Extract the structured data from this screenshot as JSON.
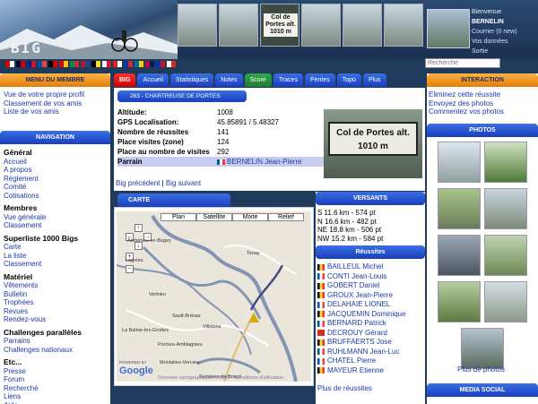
{
  "header": {
    "logo_text": "BIG",
    "thumb_sign": "Col de Portes alt. 1010 m",
    "user": {
      "welcome": "Bienvenue",
      "name": "BERNELIN",
      "mail": "Courrier (0 new)",
      "data": "Vos données",
      "logout": "Sortie"
    },
    "search_placeholder": "Recherche"
  },
  "flags": [
    {
      "colors": [
        "#d00",
        "#fff"
      ]
    },
    {
      "colors": [
        "#003",
        "#c00"
      ]
    },
    {
      "colors": [
        "#00247d",
        "#cf142b"
      ]
    },
    {
      "colors": [
        "#0055a4",
        "#ef4135"
      ]
    },
    {
      "colors": [
        "#000",
        "#dd0000"
      ]
    },
    {
      "colors": [
        "#c60b1e",
        "#ffc400"
      ]
    },
    {
      "colors": [
        "#009246",
        "#ce2b37"
      ]
    },
    {
      "colors": [
        "#ae1c28",
        "#21468b"
      ]
    },
    {
      "colors": [
        "#000",
        "#fdda24"
      ]
    },
    {
      "colors": [
        "#fff",
        "#dc143c"
      ]
    },
    {
      "colors": [
        "#d52b1e",
        "#fff"
      ]
    },
    {
      "colors": [
        "#0039a6",
        "#d52b1e"
      ]
    },
    {
      "colors": [
        "#006aa7",
        "#fecc00"
      ]
    },
    {
      "colors": [
        "#ba0c2f",
        "#00205b"
      ]
    },
    {
      "colors": [
        "#0038a8",
        "#ce1126"
      ]
    },
    {
      "colors": [
        "#fff",
        "#d52b1e"
      ]
    }
  ],
  "left_menu": {
    "member_title": "MENU DU MEMBRE",
    "member_links": [
      "Vue de votre propre profil",
      "Classement de vos amis",
      "Liste de vos amis"
    ],
    "nav_title": "NAVIGATION",
    "sections": [
      {
        "title": "Général",
        "items": [
          "Accueil",
          "A propos",
          "Règlement",
          "Comité",
          "Cotisations"
        ]
      },
      {
        "title": "Membres",
        "items": [
          "Vue générale",
          "Classement"
        ]
      },
      {
        "title": "Superliste 1000 Bigs",
        "items": [
          "Carte",
          "La liste",
          "Classement"
        ]
      },
      {
        "title": "Matériel",
        "items": [
          "Vêtements",
          "Bulletin",
          "Trophées",
          "Revues",
          "Rendez-vous"
        ]
      },
      {
        "title": "Challenges parallèles",
        "items": [
          "Parrains",
          "Challenges nationaux"
        ]
      },
      {
        "title": "Etc...",
        "items": [
          "Presse",
          "Forum",
          "Recherché",
          "Liens",
          "Aide"
        ]
      }
    ]
  },
  "tabs": [
    "BIG",
    "Accueil",
    "Statistiques",
    "Notes",
    "Score",
    "Traces",
    "Pentes",
    "Topo",
    "Plus"
  ],
  "col": {
    "title": "263 - CHARTREUSE DE PORTES",
    "rows": [
      {
        "k": "Altitude:",
        "v": "1008"
      },
      {
        "k": "GPS Localisation:",
        "v": "45.85891 / 5.48327"
      },
      {
        "k": "Nombre de réussites",
        "v": "141"
      },
      {
        "k": "Place visites (zone)",
        "v": "124"
      },
      {
        "k": "Place au nombre de visites",
        "v": "292"
      }
    ],
    "parrain_label": "Parrain",
    "parrain_value": "BERNELIN Jean-Pierre",
    "photo_sign": "Col de Portes alt. 1010 m",
    "prev": "Big précédent",
    "sep": " | ",
    "next": "Big suivant"
  },
  "map": {
    "title": "CARTE",
    "buttons": [
      "Plan",
      "Satellite",
      "Mixte",
      "Relief"
    ],
    "towns": [
      {
        "name": "Tenay"
      },
      {
        "name": "Ambérieu-en-Bugey"
      },
      {
        "name": "Lagnieu"
      },
      {
        "name": "Vertrieu"
      },
      {
        "name": "Sault-Brénaz"
      },
      {
        "name": "La Balme-les-Grottes"
      },
      {
        "name": "Villebois"
      },
      {
        "name": "Porcieu-Amblagnieu"
      },
      {
        "name": "Montalieu-Vercieu"
      },
      {
        "name": "Serrières-de-Briord"
      }
    ],
    "copyright": "Données cartographiques ©2012 - Conditions d'utilisation",
    "google": "Google",
    "powered": "POWERED BY"
  },
  "versants": {
    "title": "VERSANTS",
    "items": [
      "S 11.6 km - 574 pt",
      "N 16.6 km - 482 pt",
      "NE 18.8 km - 506 pt",
      "NW 15.2 km - 584 pt"
    ]
  },
  "reussites": {
    "title": "Réussites",
    "items": [
      {
        "name": "BAILLEUL Michel",
        "flag": [
          "#000",
          "#fdda24",
          "#ef3340"
        ]
      },
      {
        "name": "CONTI Jean-Louis",
        "flag": [
          "#0055a4",
          "#fff",
          "#ef4135"
        ]
      },
      {
        "name": "GOBERT Daniel",
        "flag": [
          "#000",
          "#fdda24",
          "#ef3340"
        ]
      },
      {
        "name": "GROUX Jean-Pierre",
        "flag": [
          "#000",
          "#fdda24",
          "#ef3340"
        ]
      },
      {
        "name": "DELAHAIE LIONEL",
        "flag": [
          "#0055a4",
          "#fff",
          "#ef4135"
        ]
      },
      {
        "name": "JACQUEMIN Dominique",
        "flag": [
          "#000",
          "#fdda24",
          "#ef3340"
        ]
      },
      {
        "name": "BERNARD Patrick",
        "flag": [
          "#0055a4",
          "#fff",
          "#ef4135"
        ]
      },
      {
        "name": "DECROUY Gérard",
        "flag": [
          "#d52b1e",
          "#d52b1e",
          "#d52b1e"
        ]
      },
      {
        "name": "BRUFFAERTS Jose",
        "flag": [
          "#000",
          "#fdda24",
          "#ef3340"
        ]
      },
      {
        "name": "RUHLMANN Jean-Luc",
        "flag": [
          "#0055a4",
          "#fff",
          "#ef4135"
        ]
      },
      {
        "name": "CHATEL Pierre",
        "flag": [
          "#0055a4",
          "#fff",
          "#ef4135"
        ]
      },
      {
        "name": "MAYEUR Etienne",
        "flag": [
          "#000",
          "#fdda24",
          "#ef3340"
        ]
      }
    ],
    "more": "Plus de réussites"
  },
  "interaction": {
    "title": "INTERACTION",
    "links": [
      "Eliminez cette réussite",
      "Envoyez des photos",
      "Commentez vos photos"
    ]
  },
  "photos": {
    "title": "PHOTOS",
    "more": "Plus de photos"
  },
  "media": {
    "title": "MEDIA SOCIAL"
  }
}
